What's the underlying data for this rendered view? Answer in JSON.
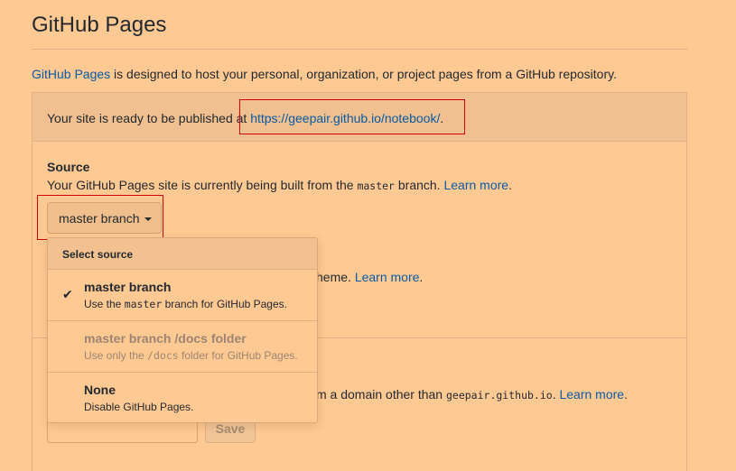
{
  "page": {
    "title": "GitHub Pages",
    "intro_link": "GitHub Pages",
    "intro_text": " is designed to host your personal, organization, or project pages from a GitHub repository."
  },
  "flash": {
    "prefix": "Your site is ready to be published at ",
    "url": "https://geepair.github.io/notebook/",
    "suffix": "."
  },
  "source": {
    "heading": "Source",
    "desc_prefix": "Your GitHub Pages site is currently being built from the ",
    "desc_branch": "master",
    "desc_suffix": " branch. ",
    "learn_more": "Learn more",
    "desc_end": ".",
    "selected": "master branch"
  },
  "dropdown": {
    "header": "Select source",
    "items": [
      {
        "title": "master branch",
        "desc_prefix": "Use the ",
        "desc_code": "master",
        "desc_suffix": " branch for GitHub Pages.",
        "checked": true,
        "disabled": false
      },
      {
        "title": "master branch /docs folder",
        "desc_prefix": "Use only the ",
        "desc_code": "/docs",
        "desc_suffix": " folder for GitHub Pages.",
        "checked": false,
        "disabled": true
      },
      {
        "title": "None",
        "desc_prefix": "Disable GitHub Pages.",
        "desc_code": "",
        "desc_suffix": "",
        "checked": false,
        "disabled": false
      }
    ]
  },
  "theme": {
    "text": "heme. ",
    "learn_more": "Learn more",
    "end": "."
  },
  "domain": {
    "text": "m a domain other than ",
    "code": "geepair.github.io",
    "after": ". ",
    "learn_more": "Learn more",
    "end": ".",
    "input_value": "",
    "save_label": "Save"
  },
  "colors": {
    "background": "#ffc993",
    "link": "#0a5aa3",
    "highlight_border": "#d40000"
  }
}
